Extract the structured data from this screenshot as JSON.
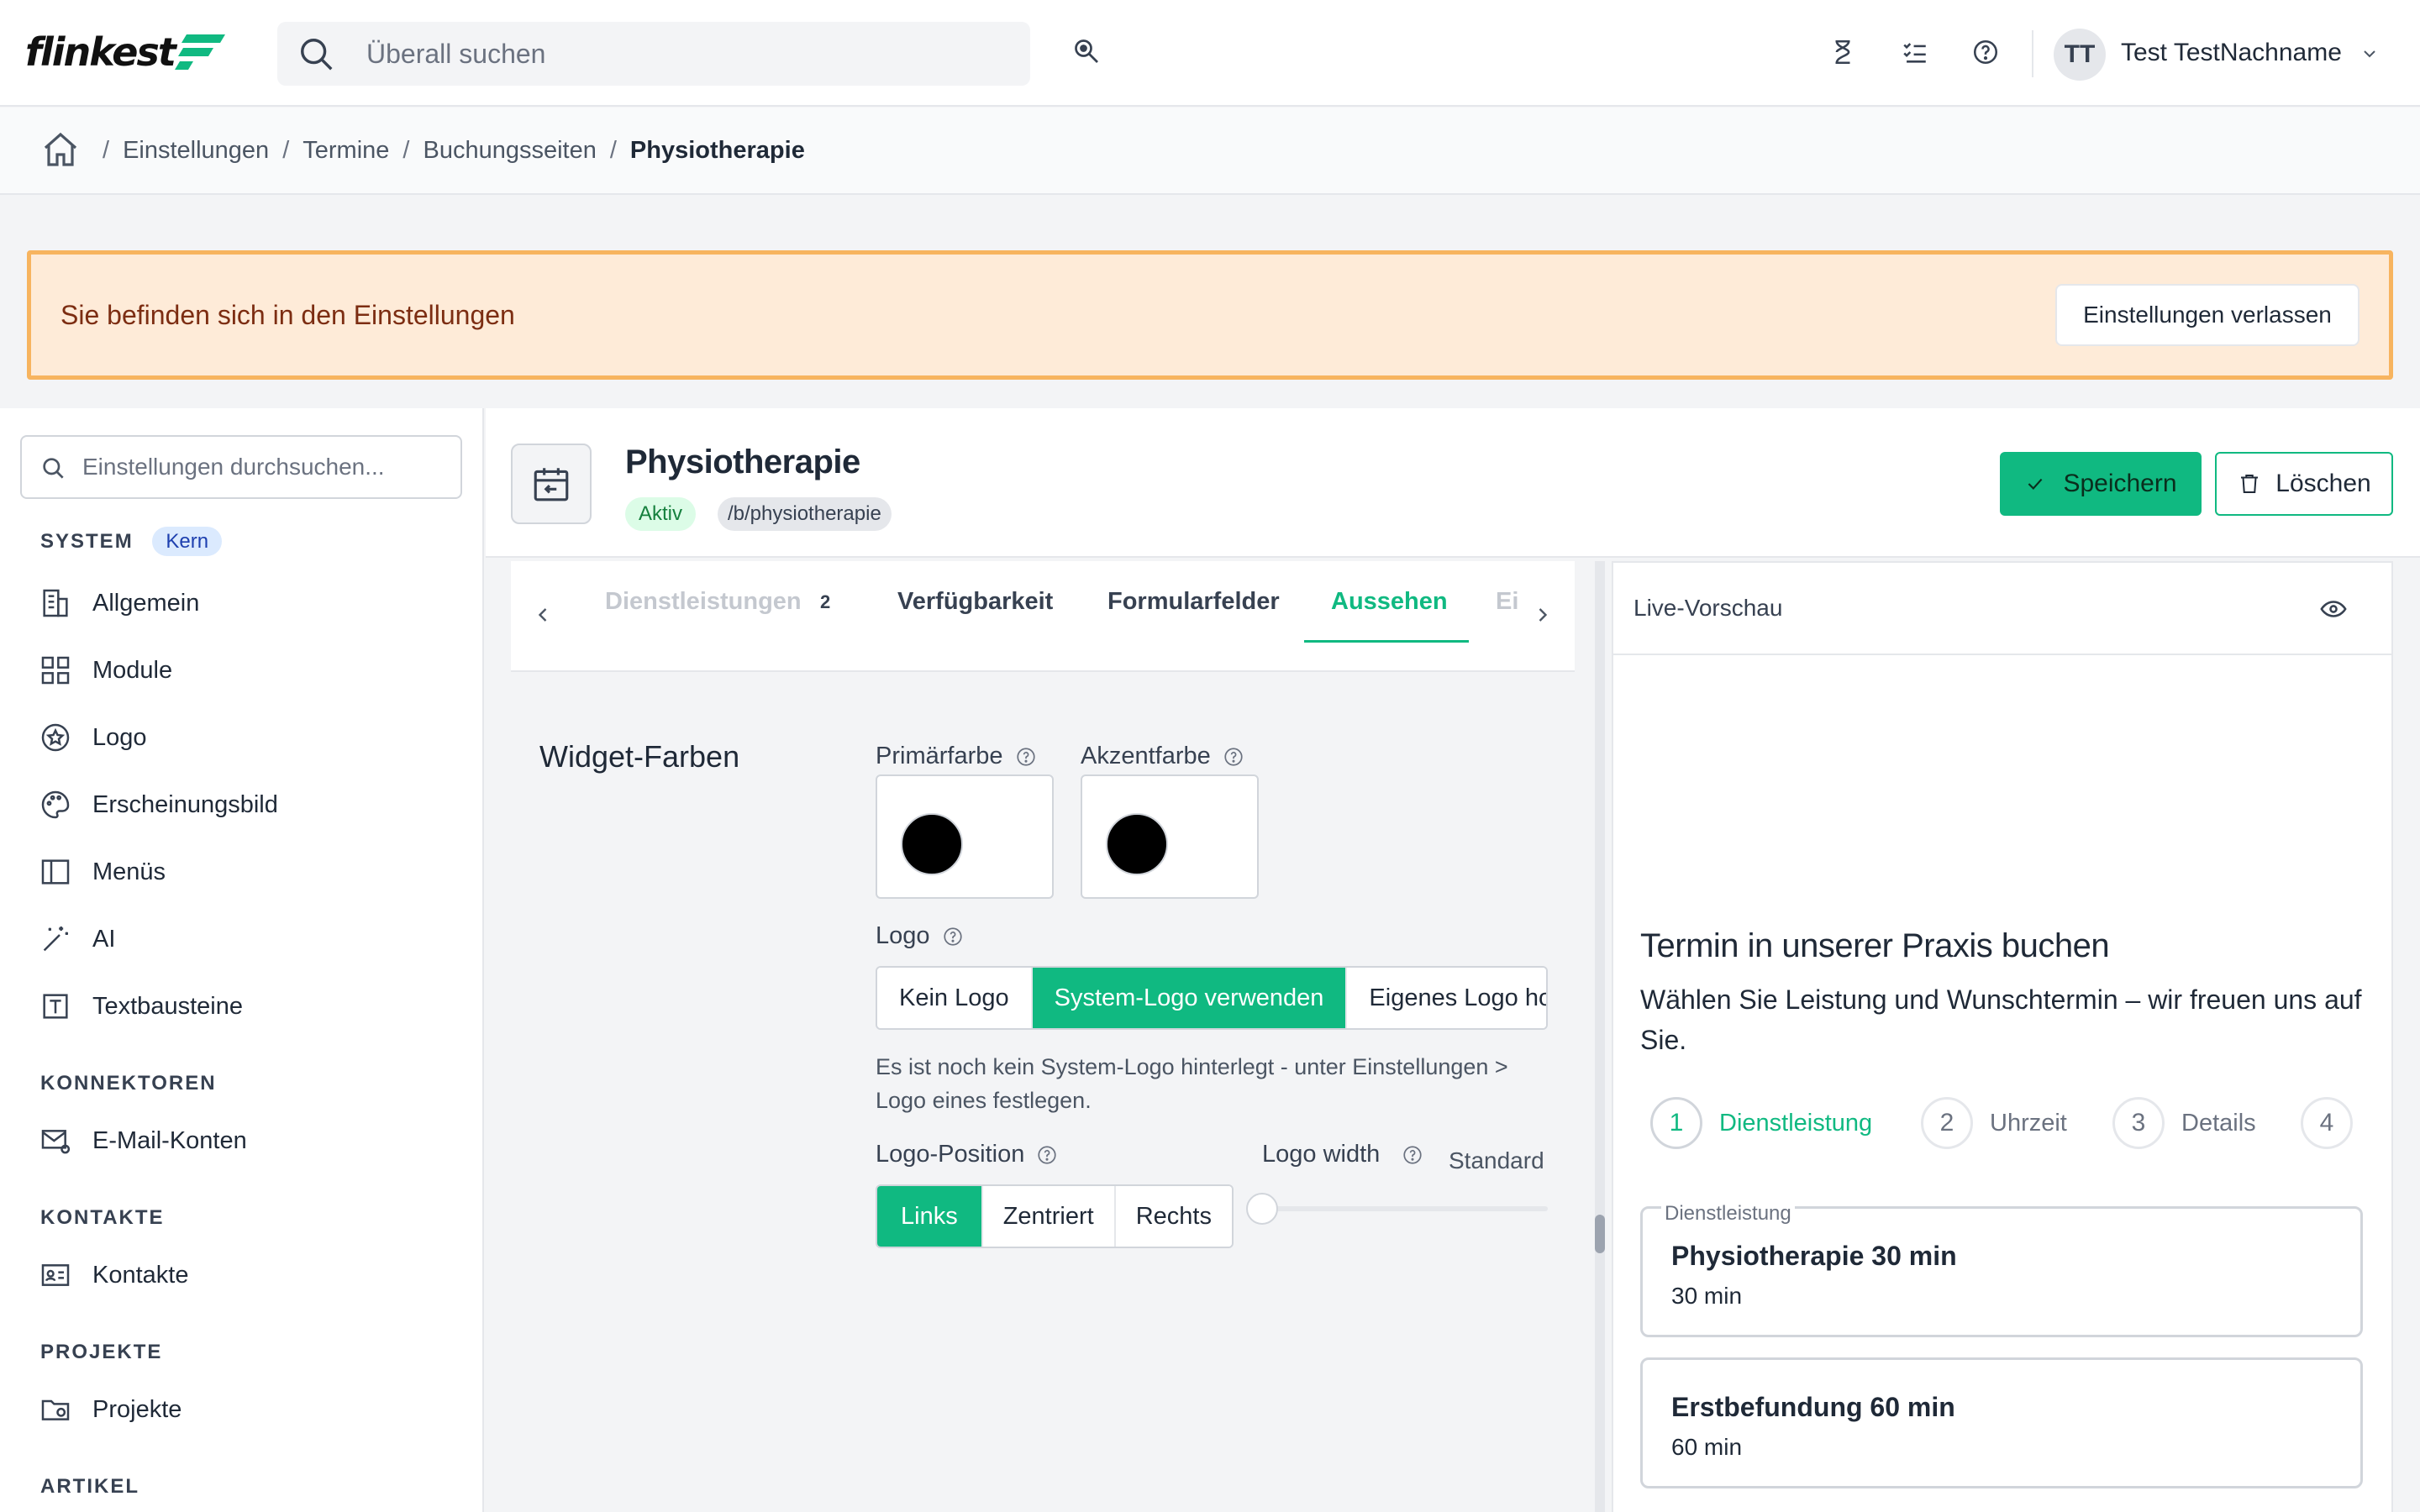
{
  "app": {
    "logo_text": "flinkest",
    "brand_color": "#10b981",
    "accent_orange": "#f7b45f"
  },
  "topbar": {
    "search_placeholder": "Überall suchen",
    "icons": [
      "search-icon",
      "hourglass-icon",
      "tasks-icon",
      "help-icon"
    ],
    "user_initials": "TT",
    "user_name": "Test TestNachname"
  },
  "breadcrumb": {
    "items": [
      "Einstellungen",
      "Termine",
      "Buchungsseiten"
    ],
    "current": "Physiotherapie"
  },
  "banner": {
    "text": "Sie befinden sich in den Einstellungen",
    "button": "Einstellungen verlassen"
  },
  "sidebar": {
    "search_placeholder": "Einstellungen durchsuchen...",
    "sections": [
      {
        "title": "SYSTEM",
        "badge": "Kern",
        "items": [
          "Allgemein",
          "Module",
          "Logo",
          "Erscheinungsbild",
          "Menüs",
          "AI",
          "Textbausteine"
        ]
      },
      {
        "title": "KONNEKTOREN",
        "items": [
          "E-Mail-Konten"
        ]
      },
      {
        "title": "KONTAKTE",
        "items": [
          "Kontakte"
        ]
      },
      {
        "title": "PROJEKTE",
        "items": [
          "Projekte"
        ]
      },
      {
        "title": "ARTIKEL",
        "items": []
      }
    ]
  },
  "page": {
    "title": "Physiotherapie",
    "status": "Aktiv",
    "slug": "/b/physiotherapie",
    "save": "Speichern",
    "delete": "Löschen"
  },
  "tabs": {
    "items": [
      {
        "label": "Dienstleistungen",
        "count": "2"
      },
      {
        "label": "Verfügbarkeit"
      },
      {
        "label": "Formularfelder"
      },
      {
        "label": "Aussehen",
        "active": true
      },
      {
        "label": "Ei"
      }
    ]
  },
  "editor": {
    "section_title": "Widget-Farben",
    "primary_label": "Primärfarbe",
    "accent_label": "Akzentfarbe",
    "primary_color": "#000000",
    "accent_color": "#000000",
    "logo_label": "Logo",
    "logo_options": [
      "Kein Logo",
      "System-Logo verwenden",
      "Eigenes Logo ho"
    ],
    "logo_selected": "System-Logo verwenden",
    "logo_hint": "Es ist noch kein System-Logo hinterlegt - unter Einstellungen > Logo eines festlegen.",
    "position_label": "Logo-Position",
    "position_options": [
      "Links",
      "Zentriert",
      "Rechts"
    ],
    "position_selected": "Links",
    "width_label": "Logo width",
    "width_value": "Standard",
    "width_slider_fraction": 0
  },
  "preview": {
    "title": "Live-Vorschau",
    "heading": "Termin in unserer Praxis buchen",
    "subheading": "Wählen Sie Leistung und Wunschtermin – wir freuen uns auf Sie.",
    "steps": [
      {
        "num": "1",
        "label": "Dienstleistung",
        "active": true
      },
      {
        "num": "2",
        "label": "Uhrzeit"
      },
      {
        "num": "3",
        "label": "Details"
      },
      {
        "num": "4",
        "label": ""
      }
    ],
    "card_caption": "Dienstleistung",
    "services": [
      {
        "name": "Physiotherapie 30 min",
        "duration": "30 min"
      },
      {
        "name": "Erstbefundung 60 min",
        "duration": "60 min"
      }
    ]
  }
}
